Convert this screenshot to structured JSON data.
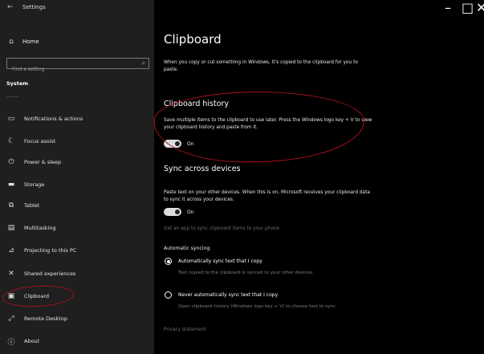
{
  "window": {
    "title": "Settings",
    "controls": [
      "–",
      "□",
      "✕"
    ]
  },
  "sidebar": {
    "home_label": "Home",
    "search_placeholder": "Find a setting",
    "section": "System",
    "partial_item": "———",
    "items": [
      {
        "label": "Notifications & actions",
        "icon": "notifications-icon"
      },
      {
        "label": "Focus assist",
        "icon": "moon-icon"
      },
      {
        "label": "Power & sleep",
        "icon": "power-icon"
      },
      {
        "label": "Storage",
        "icon": "storage-icon"
      },
      {
        "label": "Tablet",
        "icon": "tablet-icon"
      },
      {
        "label": "Multitasking",
        "icon": "multitasking-icon"
      },
      {
        "label": "Projecting to this PC",
        "icon": "projecting-icon"
      },
      {
        "label": "Shared experiences",
        "icon": "shared-experiences-icon"
      },
      {
        "label": "Clipboard",
        "icon": "clipboard-icon"
      },
      {
        "label": "Remote Desktop",
        "icon": "remote-desktop-icon"
      },
      {
        "label": "About",
        "icon": "info-icon"
      }
    ]
  },
  "content": {
    "title": "Clipboard",
    "intro": "When you copy or cut something in Windows, it's copied to the clipboard for you to paste.",
    "history": {
      "title": "Clipboard history",
      "desc": "Save multiple items to the clipboard to use later. Press the Windows logo key + V to view your clipboard history and paste from it.",
      "toggle_label": "On"
    },
    "sync": {
      "title": "Sync across devices",
      "desc": "Paste text on your other devices. When this is on, Microsoft receives your clipboard data to sync it across your devices.",
      "toggle_label": "On",
      "link": "Get an app to sync clipboard items to your phone",
      "auto_heading": "Automatic syncing",
      "option1_label": "Automatically sync text that I copy",
      "option1_desc": "Text copied to the clipboard is synced to your other devices.",
      "option2_label": "Never automatically sync text that I copy",
      "option2_desc": "Open clipboard history (Windows logo key + V) to choose text to sync."
    },
    "privacy_link": "Privacy statement"
  },
  "colors": {
    "annotation": "#a8121a",
    "sidebar_bg": "#1f1f1f",
    "content_bg": "#000000"
  }
}
